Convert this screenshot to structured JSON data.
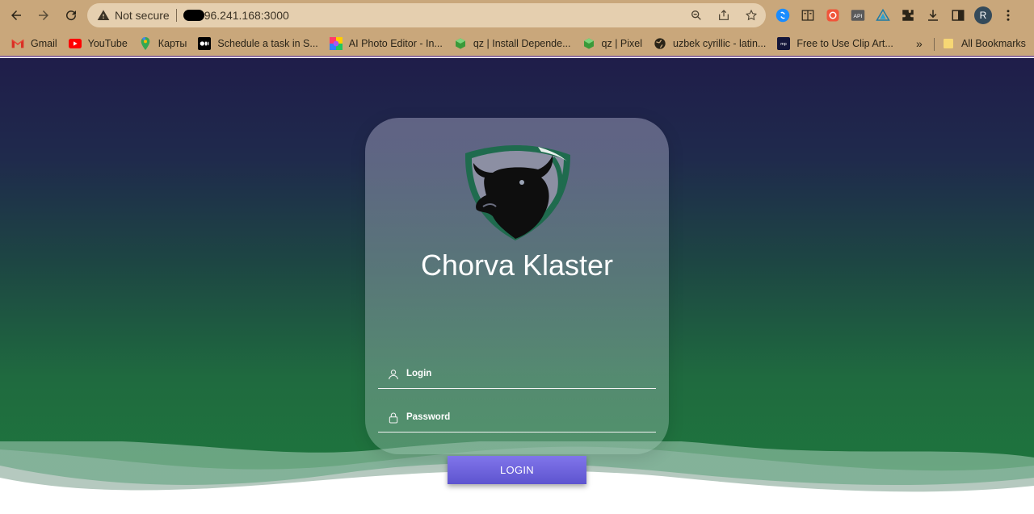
{
  "browser": {
    "security_label": "Not secure",
    "url": "96.241.168:3000",
    "avatar_initial": "R"
  },
  "bookmarks": [
    {
      "label": "Gmail",
      "icon": "gmail-icon"
    },
    {
      "label": "YouTube",
      "icon": "youtube-icon"
    },
    {
      "label": "Карты",
      "icon": "maps-icon"
    },
    {
      "label": "Schedule a task in S...",
      "icon": "medium-icon"
    },
    {
      "label": "AI Photo Editor - In...",
      "icon": "photo-editor-icon"
    },
    {
      "label": "qz | Install Depende...",
      "icon": "qz-icon"
    },
    {
      "label": "qz | Pixel",
      "icon": "qz-icon"
    },
    {
      "label": "uzbek cyrillic - latin...",
      "icon": "globe-icon"
    },
    {
      "label": "Free to Use Clip Art...",
      "icon": "clipart-icon"
    }
  ],
  "bookmarks_more": "»",
  "all_bookmarks": "All Bookmarks",
  "login_card": {
    "title": "Chorva Klaster",
    "login_placeholder": "Login",
    "password_placeholder": "Password",
    "submit_label": "LOGIN"
  },
  "colors": {
    "button": "#6d63e0",
    "card_glass": "rgba(150,180,170,0.5)",
    "page_top": "#1f1d4a",
    "page_bottom": "#1e7a3c"
  }
}
